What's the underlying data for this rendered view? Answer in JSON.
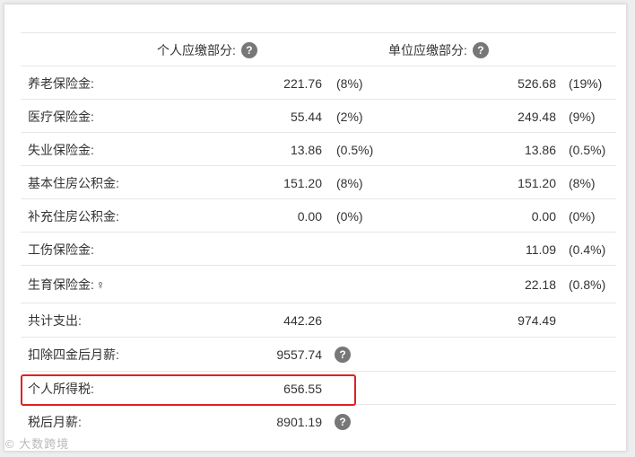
{
  "header": {
    "personal_label": "个人应缴部分:",
    "company_label": "单位应缴部分:",
    "help_glyph": "?"
  },
  "rows": [
    {
      "label": "养老保险金:",
      "personal_value": "221.76",
      "personal_pct": "(8%)",
      "company_value": "526.68",
      "company_pct": "(19%)"
    },
    {
      "label": "医疗保险金:",
      "personal_value": "55.44",
      "personal_pct": "(2%)",
      "company_value": "249.48",
      "company_pct": "(9%)"
    },
    {
      "label": "失业保险金:",
      "personal_value": "13.86",
      "personal_pct": "(0.5%)",
      "company_value": "13.86",
      "company_pct": "(0.5%)"
    },
    {
      "label": "基本住房公积金:",
      "personal_value": "151.20",
      "personal_pct": "(8%)",
      "company_value": "151.20",
      "company_pct": "(8%)"
    },
    {
      "label": "补充住房公积金:",
      "personal_value": "0.00",
      "personal_pct": "(0%)",
      "company_value": "0.00",
      "company_pct": "(0%)"
    },
    {
      "label": "工伤保险金:",
      "company_value": "11.09",
      "company_pct": "(0.4%)"
    },
    {
      "label": "生育保险金:",
      "label_symbol": "♀",
      "company_value": "22.18",
      "company_pct": "(0.8%)"
    }
  ],
  "total": {
    "label": "共计支出:",
    "personal_value": "442.26",
    "company_value": "974.49"
  },
  "after_deduction": {
    "label": "扣除四金后月薪:",
    "value": "9557.74"
  },
  "income_tax": {
    "label": "个人所得税:",
    "value": "656.55"
  },
  "after_tax": {
    "label": "税后月薪:",
    "value": "8901.19"
  },
  "watermark": "© 大数跨境"
}
